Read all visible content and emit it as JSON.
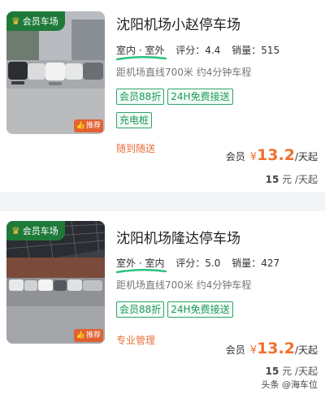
{
  "listings": [
    {
      "member_badge": "会员车场",
      "recommend_badge": "推荐",
      "name": "沈阳机场小赵停车场",
      "location": "室内 · 室外",
      "rating_label": "评分：",
      "rating": "4.4",
      "sales_label": "销量：",
      "sales": "515",
      "distance": "距机场直线700米 约4分钟车程",
      "tags": [
        "会员88折",
        "24H免费接送",
        "充电桩"
      ],
      "note": "随到随送",
      "member_label": "会员",
      "currency": "¥",
      "price": "13.2",
      "price_unit": "/天起",
      "original_price": "15",
      "original_unit": "元 /天起"
    },
    {
      "member_badge": "会员车场",
      "recommend_badge": "推荐",
      "name": "沈阳机场隆达停车场",
      "location": "室外 · 室内",
      "rating_label": "评分：",
      "rating": "5.0",
      "sales_label": "销量：",
      "sales": "427",
      "distance": "距机场直线700米 约4分钟车程",
      "tags": [
        "会员88折",
        "24H免费接送"
      ],
      "note": "专业管理",
      "member_label": "会员",
      "currency": "¥",
      "price": "13.2",
      "price_unit": "/天起",
      "original_price": "15",
      "original_unit": "元 /天起"
    }
  ],
  "watermark": "头条 @海车位",
  "colors": {
    "member_badge_bg": "#1f7a3a",
    "tag_green": "#1d9a5a",
    "price_orange": "#f0702e",
    "note_orange": "#e8713b"
  },
  "icons": {
    "crown": "crown-icon",
    "thumb": "thumbs-up-icon"
  }
}
